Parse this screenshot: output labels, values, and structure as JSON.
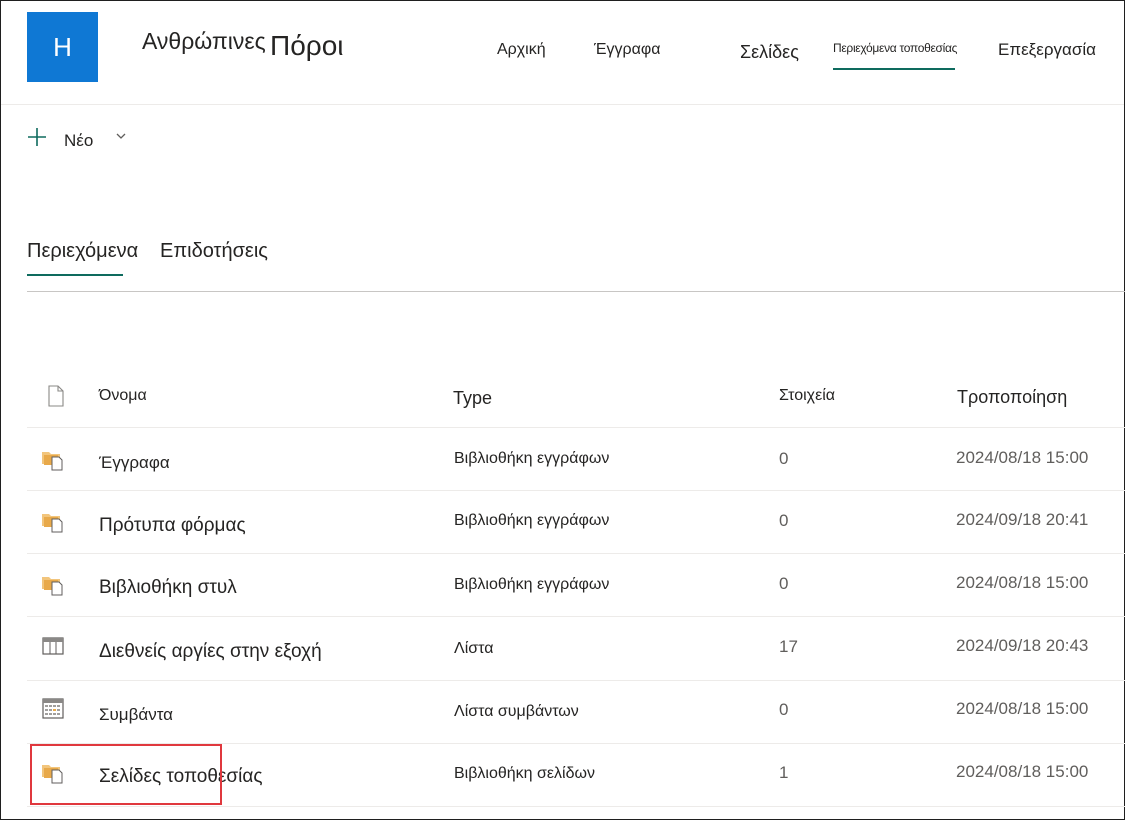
{
  "site": {
    "logo_letter": "H",
    "title_part1": "Ανθρώπινες",
    "title_part2": "Πόροι"
  },
  "nav": {
    "home": "Αρχική",
    "documents": "Έγγραφα",
    "pages": "Σελίδες",
    "site_contents": "Περιεχόμενα τοποθεσίας",
    "edit": "Επεξεργασία"
  },
  "command_bar": {
    "new_label": "Νέο"
  },
  "tabs": {
    "contents": "Περιεχόμενα",
    "grants": "Επιδοτήσεις"
  },
  "table": {
    "headers": {
      "name": "Όνομα",
      "type": "Type",
      "items": "Στοιχεία",
      "modified": "Τροποποίηση"
    },
    "rows": [
      {
        "name": "Έγγραφα",
        "type": "Βιβλιοθήκη εγγράφων",
        "items": "0",
        "modified": "2024/08/18 15:00",
        "icon": "document-library-icon"
      },
      {
        "name": "Πρότυπα φόρμας",
        "type": "Βιβλιοθήκη εγγράφων",
        "items": "0",
        "modified": "2024/09/18 20:41",
        "icon": "document-library-icon"
      },
      {
        "name": "Βιβλιοθήκη στυλ",
        "type": "Βιβλιοθήκη εγγράφων",
        "items": "0",
        "modified": "2024/08/18 15:00",
        "icon": "document-library-icon"
      },
      {
        "name": "Διεθνείς αργίες στην εξοχή",
        "type": "Λίστα",
        "items": "17",
        "modified": "2024/09/18 20:43",
        "icon": "list-icon"
      },
      {
        "name": "Συμβάντα",
        "type": "Λίστα συμβάντων",
        "items": "0",
        "modified": "2024/08/18 15:00",
        "icon": "calendar-icon"
      },
      {
        "name": "Σελίδες τοποθεσίας",
        "type": "Βιβλιοθήκη σελίδων",
        "items": "1",
        "modified": "2024/08/18 15:00",
        "icon": "document-library-icon"
      }
    ]
  },
  "colors": {
    "logo_bg": "#0f78d4",
    "accent": "#0e6b5e",
    "highlight": "#e0383e",
    "folder": "#f2c57c"
  }
}
